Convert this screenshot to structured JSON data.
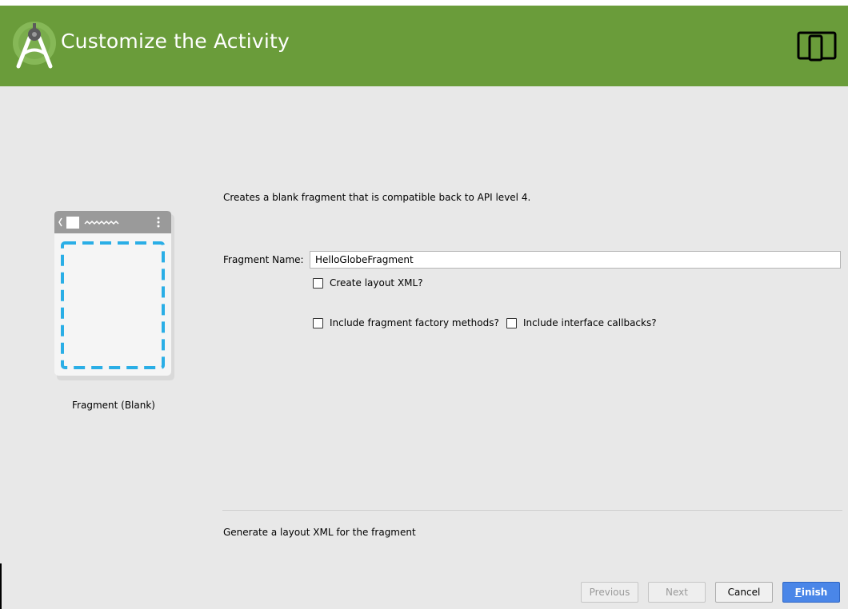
{
  "header": {
    "title": "Customize the Activity",
    "logo_icon": "android-studio-icon",
    "device_icon": "tablet-phone-icon",
    "color": "#6a9c3a"
  },
  "preview": {
    "label": "Fragment (Blank)",
    "accent_color": "#2aaee6"
  },
  "form": {
    "description": "Creates a blank fragment that is compatible back to API level 4.",
    "fragment_name_label": "Fragment Name:",
    "fragment_name_value": "HelloGlobeFragment",
    "create_layout_label": "Create layout XML?",
    "factory_methods_label": "Include fragment factory methods?",
    "interface_callbacks_label": "Include interface callbacks?"
  },
  "help_text": "Generate a layout XML for the fragment",
  "buttons": {
    "previous": "Previous",
    "next": "Next",
    "cancel": "Cancel",
    "finish_mnemonic": "F",
    "finish_rest": "inish",
    "finish_color": "#4a86e8"
  }
}
